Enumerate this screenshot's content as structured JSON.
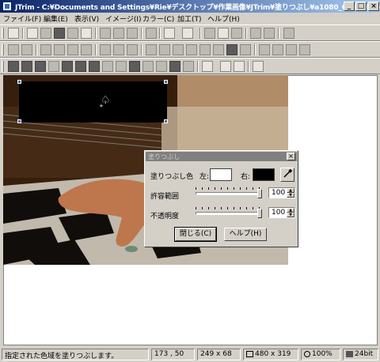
{
  "window": {
    "title": "JTrim - C:¥Documents and Settings¥Rie¥デスクトップ¥作業画像¥JTrim¥塗りつぶし¥a1080_000130.jpg",
    "minimize": "_",
    "maximize": "□",
    "close": "×"
  },
  "menu": [
    "ファイル(F)",
    "編集(E)",
    "表示(V)",
    "イメージ(I)",
    "カラー(C)",
    "加工(T)",
    "ヘルプ(H)"
  ],
  "dialog": {
    "title": "塗りつぶし",
    "close": "×",
    "fill_color_label": "塗りつぶし色",
    "left_label": "左:",
    "right_label": "右:",
    "left_color": "#ffffff",
    "right_color": "#000000",
    "eyedropper_icon": "eyedropper-icon",
    "tolerance_label": "許容範囲",
    "tolerance_value": "100",
    "opacity_label": "不透明度",
    "opacity_value": "100",
    "close_button": "閉じる(C)",
    "help_button": "ヘルプ(H)"
  },
  "status": {
    "message": "指定された色域を塗りつぶします。",
    "coords": "173 , 50",
    "selection": "249 x 68",
    "image_size": "480 x 319",
    "zoom": "100%",
    "depth": "24bit"
  },
  "colors": {
    "title_start": "#0a246a",
    "title_end": "#a6caf0",
    "face": "#d4d0c8"
  }
}
